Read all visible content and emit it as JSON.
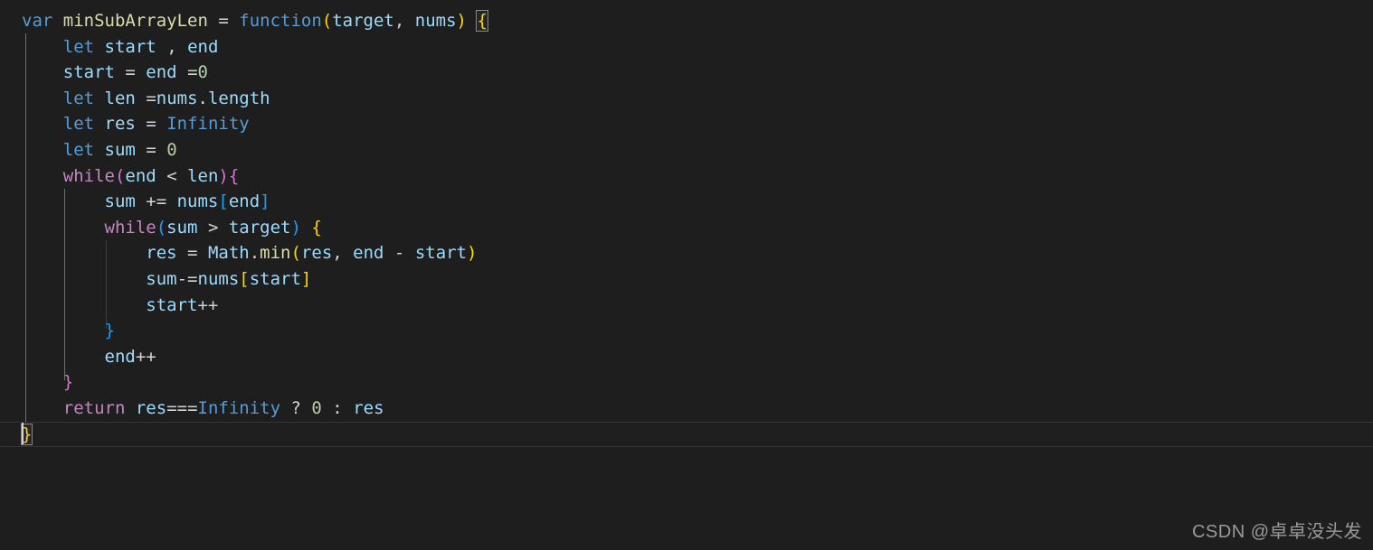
{
  "editor": {
    "language": "javascript",
    "theme": "Dark+ (default dark)",
    "background_color": "#1e1e1e",
    "foreground_color": "#d4d4d4",
    "font_size_px": 19,
    "line_height_px": 28.6,
    "tab_size": 4
  },
  "colors": {
    "keyword": "#569cd6",
    "control_keyword": "#c586c0",
    "function_name": "#dcdcaa",
    "identifier": "#9cdcfe",
    "number": "#b5cea8",
    "operator": "#d4d4d4",
    "bracket_level_1": "#ffd700",
    "bracket_level_2": "#da70d6",
    "bracket_level_3": "#179fff",
    "indent_guide": "#404040",
    "indent_guide_active": "#707070",
    "current_line_border": "#333436",
    "watermark": "#9a9a9a"
  },
  "code": {
    "clipped_line_above": "};",
    "lines": [
      {
        "indent": 0,
        "text": "var minSubArrayLen = function(target, nums) {",
        "tokens": [
          {
            "t": "var",
            "c": "kw"
          },
          {
            "t": " ",
            "c": "op"
          },
          {
            "t": "minSubArrayLen",
            "c": "fn"
          },
          {
            "t": " = ",
            "c": "op"
          },
          {
            "t": "function",
            "c": "kw"
          },
          {
            "t": "(",
            "c": "b1"
          },
          {
            "t": "target",
            "c": "var"
          },
          {
            "t": ", ",
            "c": "op"
          },
          {
            "t": "nums",
            "c": "var"
          },
          {
            "t": ")",
            "c": "b1"
          },
          {
            "t": " ",
            "c": "op"
          },
          {
            "t": "{",
            "c": "b1 match"
          }
        ]
      },
      {
        "indent": 1,
        "text": "let start , end",
        "tokens": [
          {
            "t": "let",
            "c": "kw"
          },
          {
            "t": " ",
            "c": "op"
          },
          {
            "t": "start",
            "c": "var"
          },
          {
            "t": " , ",
            "c": "op"
          },
          {
            "t": "end",
            "c": "var"
          }
        ]
      },
      {
        "indent": 1,
        "text": "start = end =0",
        "tokens": [
          {
            "t": "start",
            "c": "var"
          },
          {
            "t": " = ",
            "c": "op"
          },
          {
            "t": "end",
            "c": "var"
          },
          {
            "t": " =",
            "c": "op"
          },
          {
            "t": "0",
            "c": "num"
          }
        ]
      },
      {
        "indent": 1,
        "text": "let len =nums.length",
        "tokens": [
          {
            "t": "let",
            "c": "kw"
          },
          {
            "t": " ",
            "c": "op"
          },
          {
            "t": "len",
            "c": "var"
          },
          {
            "t": " =",
            "c": "op"
          },
          {
            "t": "nums",
            "c": "var"
          },
          {
            "t": ".",
            "c": "op"
          },
          {
            "t": "length",
            "c": "var"
          }
        ]
      },
      {
        "indent": 1,
        "text": "let res = Infinity",
        "tokens": [
          {
            "t": "let",
            "c": "kw"
          },
          {
            "t": " ",
            "c": "op"
          },
          {
            "t": "res",
            "c": "var"
          },
          {
            "t": " = ",
            "c": "op"
          },
          {
            "t": "Infinity",
            "c": "kw"
          }
        ]
      },
      {
        "indent": 1,
        "text": "let sum = 0",
        "tokens": [
          {
            "t": "let",
            "c": "kw"
          },
          {
            "t": " ",
            "c": "op"
          },
          {
            "t": "sum",
            "c": "var"
          },
          {
            "t": " = ",
            "c": "op"
          },
          {
            "t": "0",
            "c": "num"
          }
        ]
      },
      {
        "indent": 1,
        "text": "while(end < len){",
        "tokens": [
          {
            "t": "while",
            "c": "ctl"
          },
          {
            "t": "(",
            "c": "b2"
          },
          {
            "t": "end",
            "c": "var"
          },
          {
            "t": " < ",
            "c": "op"
          },
          {
            "t": "len",
            "c": "var"
          },
          {
            "t": ")",
            "c": "b2"
          },
          {
            "t": "{",
            "c": "b2"
          }
        ]
      },
      {
        "indent": 2,
        "text": "sum += nums[end]",
        "tokens": [
          {
            "t": "sum",
            "c": "var"
          },
          {
            "t": " += ",
            "c": "op"
          },
          {
            "t": "nums",
            "c": "var"
          },
          {
            "t": "[",
            "c": "b3"
          },
          {
            "t": "end",
            "c": "var"
          },
          {
            "t": "]",
            "c": "b3"
          }
        ]
      },
      {
        "indent": 2,
        "text": "while(sum > target) {",
        "tokens": [
          {
            "t": "while",
            "c": "ctl"
          },
          {
            "t": "(",
            "c": "b3"
          },
          {
            "t": "sum",
            "c": "var"
          },
          {
            "t": " > ",
            "c": "op"
          },
          {
            "t": "target",
            "c": "var"
          },
          {
            "t": ")",
            "c": "b3"
          },
          {
            "t": " ",
            "c": "op"
          },
          {
            "t": "{",
            "c": "b1"
          }
        ]
      },
      {
        "indent": 3,
        "text": "res = Math.min(res, end - start)",
        "tokens": [
          {
            "t": "res",
            "c": "var"
          },
          {
            "t": " = ",
            "c": "op"
          },
          {
            "t": "Math",
            "c": "var"
          },
          {
            "t": ".",
            "c": "op"
          },
          {
            "t": "min",
            "c": "fn"
          },
          {
            "t": "(",
            "c": "b1"
          },
          {
            "t": "res",
            "c": "var"
          },
          {
            "t": ", ",
            "c": "op"
          },
          {
            "t": "end",
            "c": "var"
          },
          {
            "t": " - ",
            "c": "op"
          },
          {
            "t": "start",
            "c": "var"
          },
          {
            "t": ")",
            "c": "b1"
          }
        ]
      },
      {
        "indent": 3,
        "text": "sum-=nums[start]",
        "tokens": [
          {
            "t": "sum",
            "c": "var"
          },
          {
            "t": "-=",
            "c": "op"
          },
          {
            "t": "nums",
            "c": "var"
          },
          {
            "t": "[",
            "c": "b1"
          },
          {
            "t": "start",
            "c": "var"
          },
          {
            "t": "]",
            "c": "b1"
          }
        ]
      },
      {
        "indent": 3,
        "text": "start++",
        "tokens": [
          {
            "t": "start",
            "c": "var"
          },
          {
            "t": "++",
            "c": "op"
          }
        ]
      },
      {
        "indent": 2,
        "text": "}",
        "tokens": [
          {
            "t": "}",
            "c": "b3"
          }
        ]
      },
      {
        "indent": 2,
        "text": "end++",
        "tokens": [
          {
            "t": "end",
            "c": "var"
          },
          {
            "t": "++",
            "c": "op"
          }
        ]
      },
      {
        "indent": 1,
        "text": "}",
        "tokens": [
          {
            "t": "}",
            "c": "b2"
          }
        ]
      },
      {
        "indent": 1,
        "text": "return res===Infinity ? 0 : res",
        "tokens": [
          {
            "t": "return",
            "c": "ctl"
          },
          {
            "t": " ",
            "c": "op"
          },
          {
            "t": "res",
            "c": "var"
          },
          {
            "t": "===",
            "c": "op"
          },
          {
            "t": "Infinity",
            "c": "kw"
          },
          {
            "t": " ",
            "c": "op"
          },
          {
            "t": "?",
            "c": "op"
          },
          {
            "t": " ",
            "c": "op"
          },
          {
            "t": "0",
            "c": "num"
          },
          {
            "t": " ",
            "c": "op"
          },
          {
            "t": ":",
            "c": "op"
          },
          {
            "t": " ",
            "c": "op"
          },
          {
            "t": "res",
            "c": "var"
          }
        ]
      },
      {
        "indent": 0,
        "current": true,
        "text": "}",
        "tokens": [
          {
            "t": "}",
            "c": "b1 match"
          }
        ]
      }
    ]
  },
  "watermark": {
    "text": "CSDN @卓卓没头发"
  }
}
